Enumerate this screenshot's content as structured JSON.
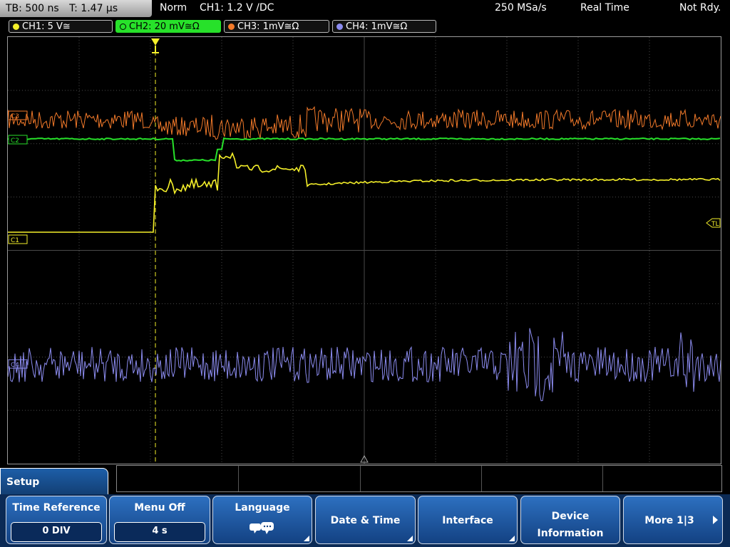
{
  "header": {
    "timebase": "TB: 500 ns",
    "trigger_time": "T: 1.47 µs",
    "mode": "Norm",
    "trigger": "CH1: 1.2 V /DC",
    "sample_rate": "250 MSa/s",
    "acq_mode": "Real Time",
    "status": "Not Rdy."
  },
  "channels": [
    {
      "label": "CH1: 5 V≅",
      "color": "#f5f02a"
    },
    {
      "label": "CH2: 20 mV≅Ω",
      "color": "#27e12a"
    },
    {
      "label": "CH3: 1mV≅Ω",
      "color": "#f37a2a"
    },
    {
      "label": "CH4: 1mV≅Ω",
      "color": "#8c8cf0"
    }
  ],
  "markers": {
    "trigger_level": "TL",
    "ch1": "C1",
    "ch2": "C2",
    "ch3": "C3",
    "ch4": "C4"
  },
  "menu": {
    "title": "Setup",
    "softkeys": [
      {
        "label": "Time Reference",
        "value": "0 DIV"
      },
      {
        "label": "Menu Off",
        "value": "4 s"
      },
      {
        "label": "Language",
        "icon": "speech-bubbles-icon"
      },
      {
        "label": "Date & Time"
      },
      {
        "label": "Interface"
      },
      {
        "label": "Device",
        "label2": "Information"
      },
      {
        "label": "More 1|3"
      }
    ]
  },
  "colors": {
    "grid": "#4a4a4a",
    "softkey": "#1f5eaa",
    "active_channel": "#27e12a"
  }
}
